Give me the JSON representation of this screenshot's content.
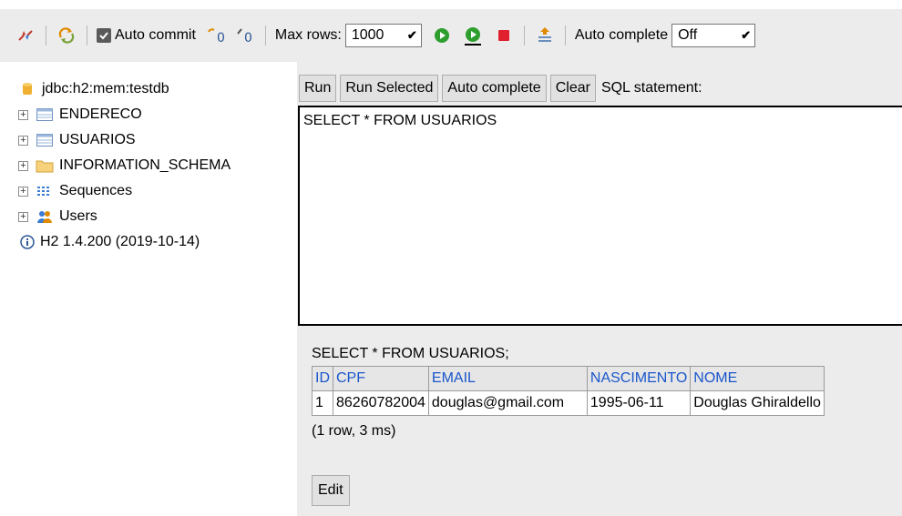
{
  "toolbar": {
    "auto_commit_label": "Auto commit",
    "max_rows_label": "Max rows:",
    "max_rows_value": "1000",
    "auto_complete_label": "Auto complete",
    "auto_complete_value": "Off",
    "icons": [
      "disconnect-icon",
      "refresh-icon",
      "checkbox-checked-icon",
      "rollback-icon",
      "commit-icon",
      "run-icon",
      "run-selected-icon",
      "stop-icon",
      "history-icon"
    ]
  },
  "tree": {
    "connection": "jdbc:h2:mem:testdb",
    "items": [
      {
        "label": "ENDERECO",
        "icon": "table-icon"
      },
      {
        "label": "USUARIOS",
        "icon": "table-icon"
      },
      {
        "label": "INFORMATION_SCHEMA",
        "icon": "folder-icon"
      },
      {
        "label": "Sequences",
        "icon": "sequence-icon"
      },
      {
        "label": "Users",
        "icon": "users-icon"
      }
    ],
    "version": "H2 1.4.200 (2019-10-14)",
    "expander_symbol": "+"
  },
  "editor": {
    "buttons": {
      "run": "Run",
      "run_selected": "Run Selected",
      "auto_complete": "Auto complete",
      "clear": "Clear"
    },
    "sql_label": "SQL statement:",
    "sql_text": "SELECT * FROM USUARIOS"
  },
  "results": {
    "query": "SELECT * FROM USUARIOS;",
    "columns": [
      "ID",
      "CPF",
      "EMAIL",
      "NASCIMENTO",
      "NOME"
    ],
    "rows": [
      [
        "1",
        "86260782004",
        "douglas@gmail.com",
        "1995-06-11",
        "Douglas Ghiraldello"
      ]
    ],
    "row_info": "(1 row, 3 ms)",
    "edit_label": "Edit"
  }
}
